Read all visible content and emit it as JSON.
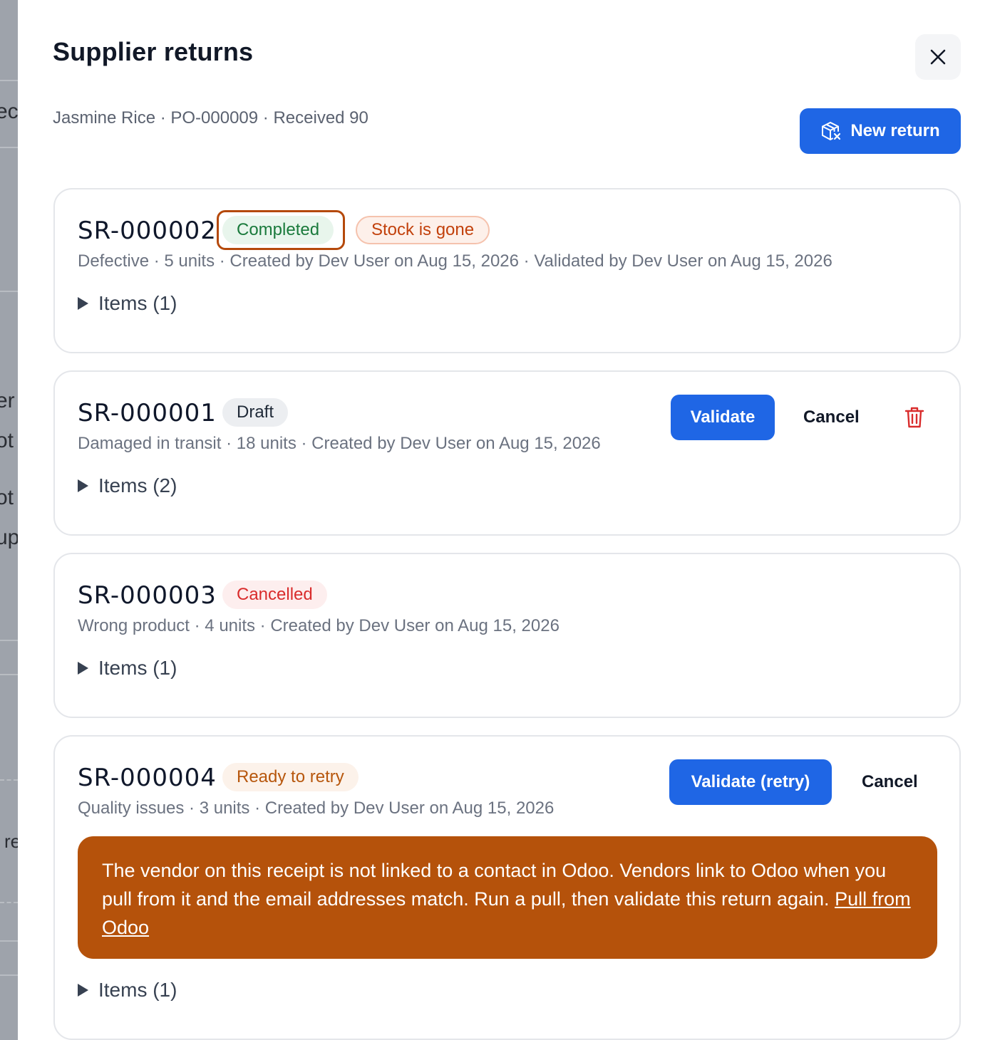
{
  "background": {
    "fragments": [
      "ec",
      "er",
      "ot",
      "ot",
      "up",
      "re"
    ]
  },
  "modal": {
    "title": "Supplier returns",
    "close_icon": "close-icon",
    "subtitle": "Jasmine Rice · PO-000009 · Received 90",
    "new_return_label": "New return",
    "new_return_icon": "package-x-icon"
  },
  "returns": [
    {
      "id": "SR-000002",
      "status": "Completed",
      "extra_badge": "Stock is gone",
      "meta": "Defective · 5 units · Created by Dev User on Aug 15, 2026 · Validated by Dev User on Aug 15, 2026",
      "items_label": "Items (1)"
    },
    {
      "id": "SR-000001",
      "status": "Draft",
      "meta": "Damaged in transit · 18 units · Created by Dev User on Aug 15, 2026",
      "items_label": "Items (2)",
      "validate_label": "Validate",
      "cancel_label": "Cancel",
      "delete_icon": "trash-icon"
    },
    {
      "id": "SR-000003",
      "status": "Cancelled",
      "meta": "Wrong product · 4 units · Created by Dev User on Aug 15, 2026",
      "items_label": "Items (1)"
    },
    {
      "id": "SR-000004",
      "status": "Ready to retry",
      "meta": "Quality issues · 3 units · Created by Dev User on Aug 15, 2026",
      "items_label": "Items (1)",
      "validate_label": "Validate (retry)",
      "cancel_label": "Cancel",
      "error_message": "The vendor on this receipt is not linked to a contact in Odoo. Vendors link to Odoo when you pull from it and the email addresses match. Run a pull, then validate this return again.",
      "error_link": "Pull from Odoo"
    }
  ],
  "colors": {
    "primary": "#1f66e5",
    "completed": "#1a7a3c",
    "stock_gone": "#c2410c",
    "cancelled": "#d92c2c",
    "retry": "#b7570d",
    "alert_bg": "#b5520b"
  }
}
